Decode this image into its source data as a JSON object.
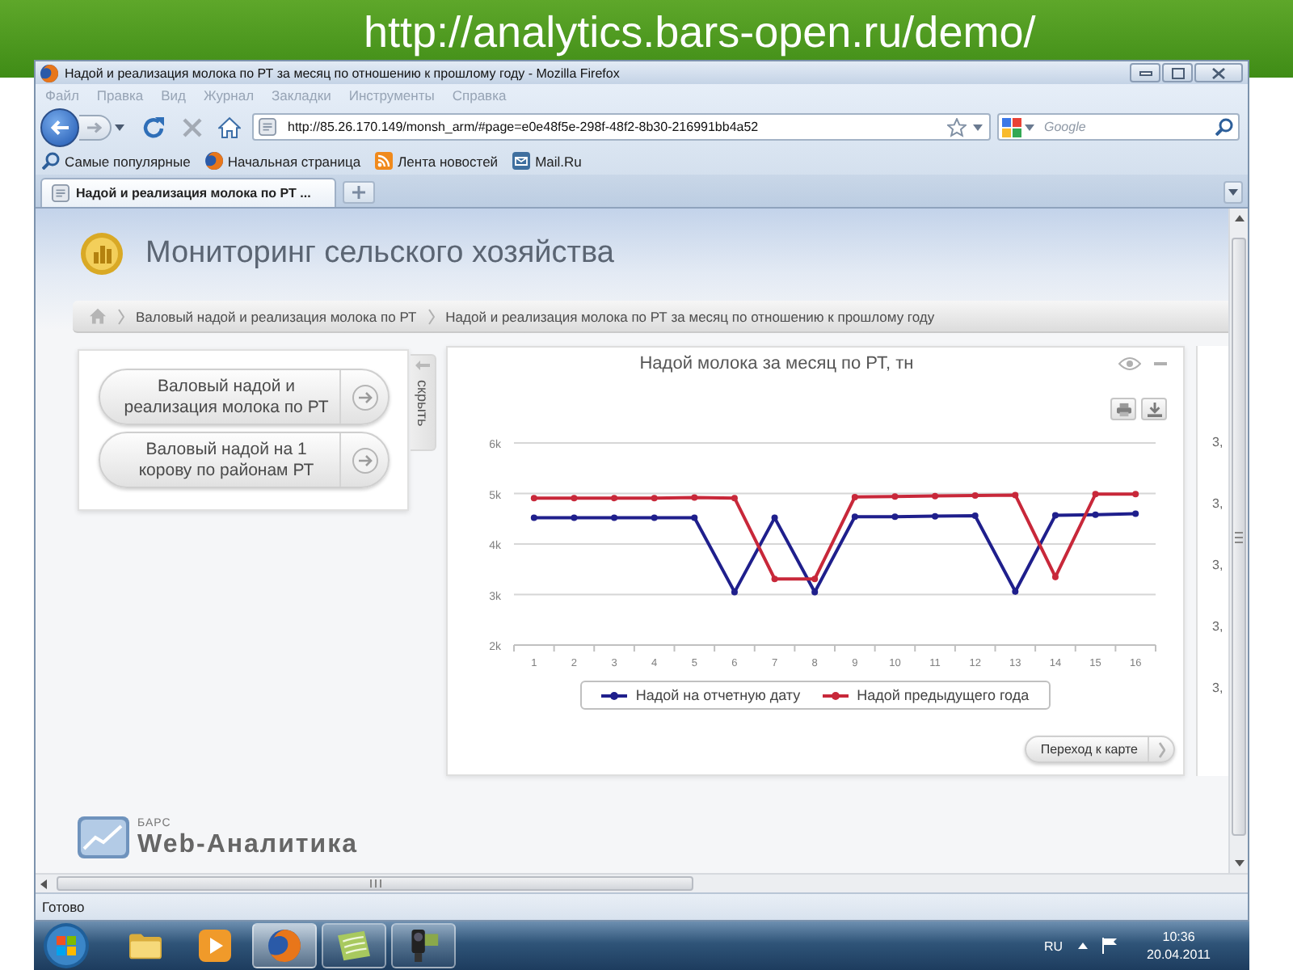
{
  "banner": {
    "url": "http://analytics.bars-open.ru/demo/"
  },
  "window": {
    "title": "Надой и реализация молока по РТ за месяц по отношению к прошлому году - Mozilla Firefox"
  },
  "menu": [
    "Файл",
    "Правка",
    "Вид",
    "Журнал",
    "Закладки",
    "Инструменты",
    "Справка"
  ],
  "toolbar": {
    "address": "http://85.26.170.149/monsh_arm/#page=e0e48f5e-298f-48f2-8b30-216991bb4a52",
    "search": {
      "placeholder": "Google"
    }
  },
  "bookmarks": [
    {
      "kind": "search",
      "label": "Самые популярные"
    },
    {
      "kind": "browser",
      "label": "Начальная страница"
    },
    {
      "kind": "feed",
      "label": "Лента новостей"
    },
    {
      "kind": "mail",
      "label": "Mail.Ru"
    }
  ],
  "tabs": [
    {
      "label": "Надой и реализация молока по РТ ...",
      "selected": true
    }
  ],
  "page": {
    "title": "Мониторинг сельского хозяйства",
    "breadcrumbs": [
      "Валовый надой и реализация молока по РТ",
      "Надой и реализация молока по РТ за месяц по отношению к прошлому году"
    ],
    "reports": [
      "Валовый надой и реализация молока по РТ",
      "Валовый надой на 1 корову по районам РТ"
    ],
    "hide_label": "скрыть",
    "chart_panel": {
      "chart_data": {
        "type": "line",
        "title": "Надой молока за месяц по РТ, тн",
        "categories": [
          "1",
          "2",
          "3",
          "4",
          "5",
          "6",
          "7",
          "8",
          "9",
          "10",
          "11",
          "12",
          "13",
          "14",
          "15",
          "16"
        ],
        "series": [
          {
            "name": "Надой на отчетную дату",
            "color": "#1f1f8c",
            "marker": "circle",
            "values": [
              4520,
              4520,
              4520,
              4520,
              4520,
              3050,
              4520,
              3050,
              4540,
              4540,
              4550,
              4560,
              3060,
              4570,
              4580,
              4600
            ]
          },
          {
            "name": "Надой предыдущего года",
            "color": "#c8283a",
            "marker": "circle",
            "values": [
              4910,
              4910,
              4910,
              4910,
              4920,
              4910,
              3310,
              3310,
              4930,
              4940,
              4950,
              4960,
              4970,
              3350,
              4990,
              4990
            ]
          }
        ],
        "ylim": [
          2000,
          6000
        ],
        "yticks": [
          {
            "value": 2000,
            "label": "2k"
          },
          {
            "value": 3000,
            "label": "3k"
          },
          {
            "value": 4000,
            "label": "4k"
          },
          {
            "value": 5000,
            "label": "5k"
          },
          {
            "value": 6000,
            "label": "6k"
          }
        ],
        "grid": true
      },
      "map_button": "Переход к карте"
    },
    "side_panel": {
      "labels": [
        "3,",
        "3,",
        "3,",
        "3,",
        "3,"
      ]
    },
    "footer": {
      "company": "БАРС",
      "product": "Web-Аналитика"
    }
  },
  "status_bar": {
    "text": "Готово"
  },
  "taskbar": {
    "apps": [
      {
        "kind": "folder",
        "running": false,
        "selected": false
      },
      {
        "kind": "player",
        "running": false,
        "selected": false
      },
      {
        "kind": "browser",
        "running": true,
        "selected": true
      },
      {
        "kind": "notes",
        "running": true,
        "selected": false
      },
      {
        "kind": "camera",
        "running": true,
        "selected": false
      }
    ],
    "language": "RU",
    "time": "10:36",
    "date": "20.04.2011"
  }
}
